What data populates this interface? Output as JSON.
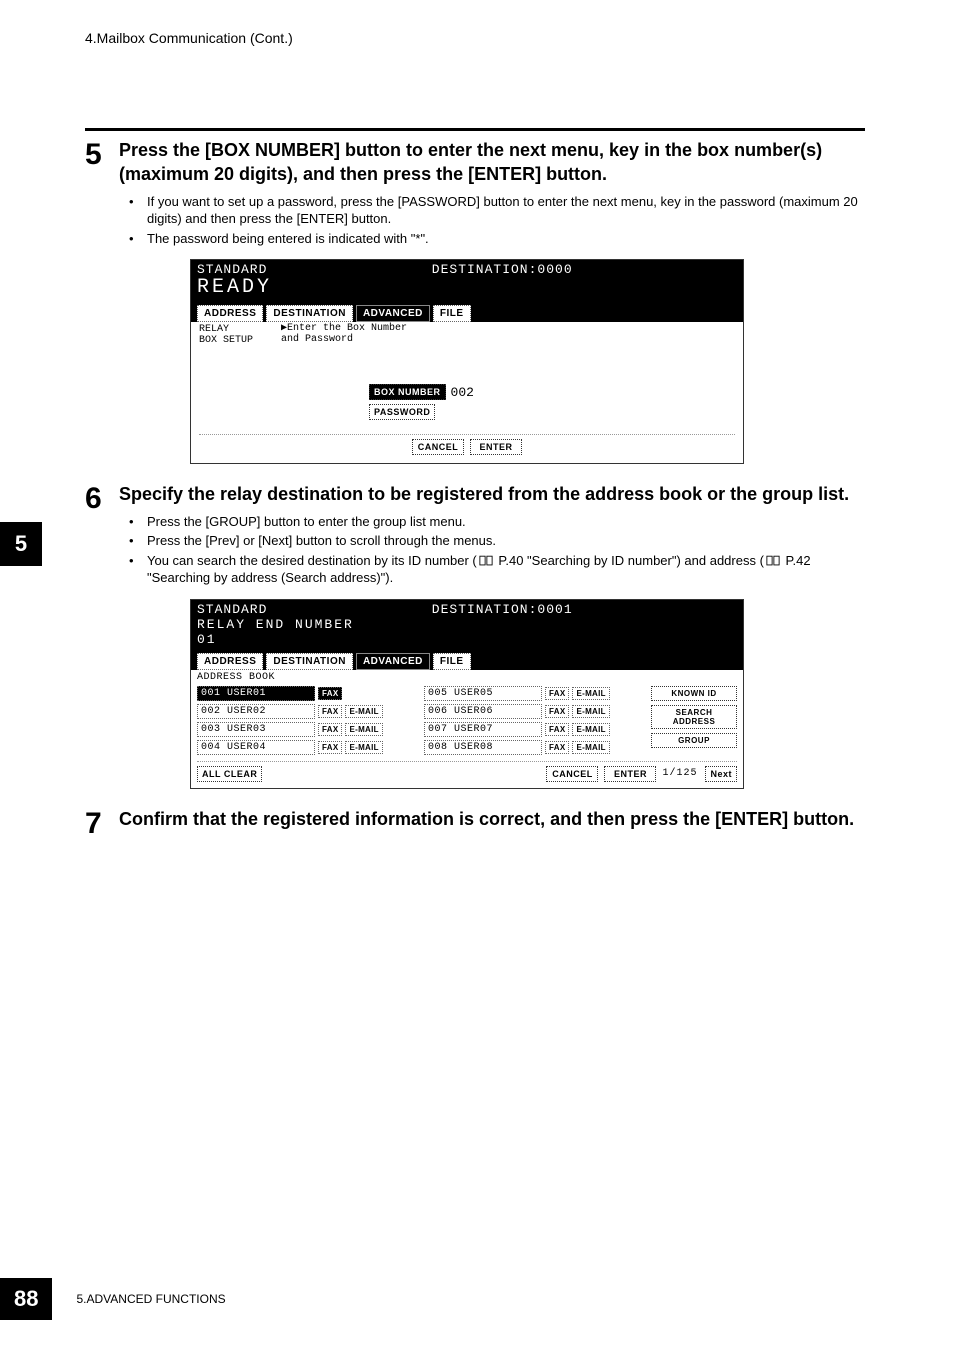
{
  "header": {
    "text": "4.Mailbox Communication (Cont.)"
  },
  "sidebar": {
    "chapter": "5"
  },
  "step5": {
    "num": "5",
    "title": "Press the [BOX NUMBER] button to enter the next menu, key in the box number(s) (maximum 20 digits), and then press the [ENTER] button.",
    "b1": "If you want to set up a password, press the [PASSWORD] button to enter the next menu, key in the password (maximum 20 digits) and then press the [ENTER] button.",
    "b2": "The password being entered is indicated with \"*\"."
  },
  "lcd1": {
    "status": "STANDARD",
    "dest": "DESTINATION:0000",
    "ready": "READY",
    "tabs": {
      "t1": "ADDRESS",
      "t2": "DESTINATION",
      "t3": "ADVANCED",
      "t4": "FILE"
    },
    "left_l1": "RELAY",
    "left_l2": "BOX SETUP",
    "right_l1": "▶Enter the Box Number",
    "right_l2": "and Password",
    "boxnum_label": "BOX NUMBER",
    "boxnum_val": "002",
    "pwd_label": "PASSWORD",
    "cancel": "CANCEL",
    "enter": "ENTER"
  },
  "step6": {
    "num": "6",
    "title": "Specify the relay destination to be registered from the address book or the group list.",
    "b1": "Press the [GROUP] button to enter the group list menu.",
    "b2": "Press the [Prev] or [Next] button to scroll through the menus.",
    "b3a": "You can search the desired destination by its ID number (",
    "b3b": " P.40 \"Searching by ID number\") and address (",
    "b3c": " P.42 \"Searching by address (Search address)\")."
  },
  "lcd2": {
    "status": "STANDARD",
    "dest": "DESTINATION:0001",
    "sub1": "RELAY END NUMBER",
    "sub2": "01",
    "tabs": {
      "t1": "ADDRESS",
      "t2": "DESTINATION",
      "t3": "ADVANCED",
      "t4": "FILE"
    },
    "ab_label": "ADDRESS BOOK",
    "col1": [
      {
        "name": "001 USER01",
        "fax": "FAX",
        "email": ""
      },
      {
        "name": "002 USER02",
        "fax": "FAX",
        "email": "E-MAIL"
      },
      {
        "name": "003 USER03",
        "fax": "FAX",
        "email": "E-MAIL"
      },
      {
        "name": "004 USER04",
        "fax": "FAX",
        "email": "E-MAIL"
      }
    ],
    "col2": [
      {
        "name": "005 USER05",
        "fax": "FAX",
        "email": "E-MAIL"
      },
      {
        "name": "006 USER06",
        "fax": "FAX",
        "email": "E-MAIL"
      },
      {
        "name": "007 USER07",
        "fax": "FAX",
        "email": "E-MAIL"
      },
      {
        "name": "008 USER08",
        "fax": "FAX",
        "email": "E-MAIL"
      }
    ],
    "side": {
      "known": "KNOWN ID",
      "search": "SEARCH ADDRESS",
      "group": "GROUP"
    },
    "allclear": "ALL CLEAR",
    "cancel": "CANCEL",
    "enter": "ENTER",
    "page": "1/125",
    "next": "Next"
  },
  "step7": {
    "num": "7",
    "title": "Confirm that the registered information is correct, and then press the [ENTER] button."
  },
  "footer": {
    "pagenum": "88",
    "chapter": "5.ADVANCED FUNCTIONS"
  }
}
